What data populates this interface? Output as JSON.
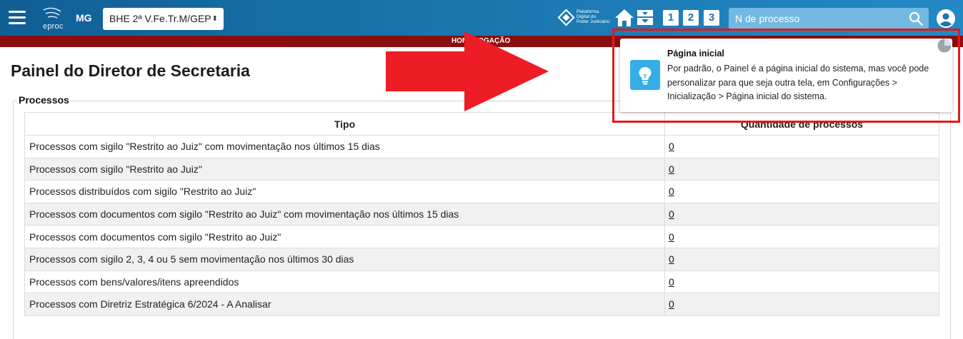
{
  "header": {
    "logo_text": "eproc",
    "state": "MG",
    "unit_select_value": "BHE 2ª V.Fe.Tr.M/GEP",
    "platform_logo_lines": [
      "Plataforma",
      "Digital do",
      "Poder Judiciário"
    ],
    "shortcut_buttons": [
      "1",
      "2",
      "3"
    ],
    "search_placeholder": "N de processo",
    "icons": [
      "menu-icon",
      "home-icon",
      "inbox-icon",
      "search-icon",
      "user-icon"
    ]
  },
  "env_banner": "HOMOLOGAÇÃO",
  "page_title": "Painel do Diretor de Secretaria",
  "section": {
    "legend": "Processos",
    "table": {
      "headers": [
        "Tipo",
        "Quantidade de processos"
      ],
      "rows": [
        {
          "tipo": "Processos com sigilo \"Restrito ao Juiz\" com movimentação nos últimos 15 dias",
          "qtd": "0"
        },
        {
          "tipo": "Processos com sigilo \"Restrito ao Juiz\"",
          "qtd": "0"
        },
        {
          "tipo": "Processos distribuídos com sigilo \"Restrito ao Juiz\"",
          "qtd": "0"
        },
        {
          "tipo": "Processos com documentos com sigilo \"Restrito ao Juiz\" com movimentação nos últimos 15 dias",
          "qtd": "0"
        },
        {
          "tipo": "Processos com documentos com sigilo \"Restrito ao Juiz\"",
          "qtd": "0"
        },
        {
          "tipo": "Processos com sigilo 2, 3, 4 ou 5 sem movimentação nos últimos 30 dias",
          "qtd": "0"
        },
        {
          "tipo": "Processos com bens/valores/itens apreendidos",
          "qtd": "0"
        },
        {
          "tipo": "Processos com Diretriz Estratégica 6/2024 - A Analisar",
          "qtd": "0"
        }
      ]
    }
  },
  "notification": {
    "title": "Página inicial",
    "text": "Por padrão, o Painel é a página inicial do sistema, mas você pode personalizar para que seja outra tela, em Configurações > Inicialização > Página inicial do sistema.",
    "icon": "lightbulb-icon"
  },
  "colors": {
    "header_start": "#0f5f95",
    "header_end": "#2389c4",
    "env_banner": "#8b0e0e",
    "annotation_red": "#e21a1a",
    "notification_icon_bg": "#35aee5"
  }
}
